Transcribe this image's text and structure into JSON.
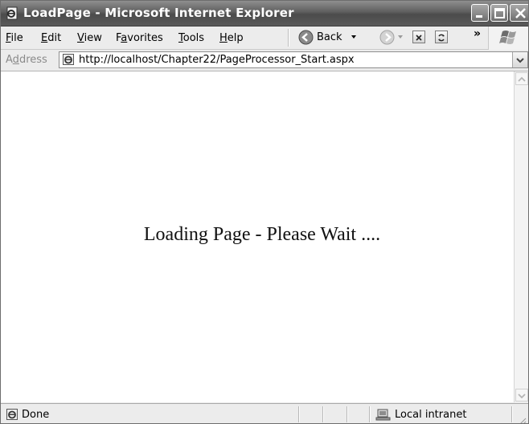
{
  "window": {
    "title": "LoadPage - Microsoft Internet Explorer"
  },
  "menu": {
    "items": [
      {
        "accel": "F",
        "rest": "ile"
      },
      {
        "accel": "E",
        "rest": "dit"
      },
      {
        "accel": "V",
        "rest": "iew"
      },
      {
        "pre": "F",
        "accel": "a",
        "rest": "vorites"
      },
      {
        "accel": "T",
        "rest": "ools"
      },
      {
        "accel": "H",
        "rest": "elp"
      }
    ]
  },
  "toolbar": {
    "back_label": "Back",
    "more": "»"
  },
  "address": {
    "label_pre": "A",
    "label_accel": "d",
    "label_rest": "dress",
    "url": "http://localhost/Chapter22/PageProcessor_Start.aspx"
  },
  "page": {
    "message": "Loading Page - Please Wait ...."
  },
  "status": {
    "text": "Done",
    "zone": "Local intranet"
  }
}
